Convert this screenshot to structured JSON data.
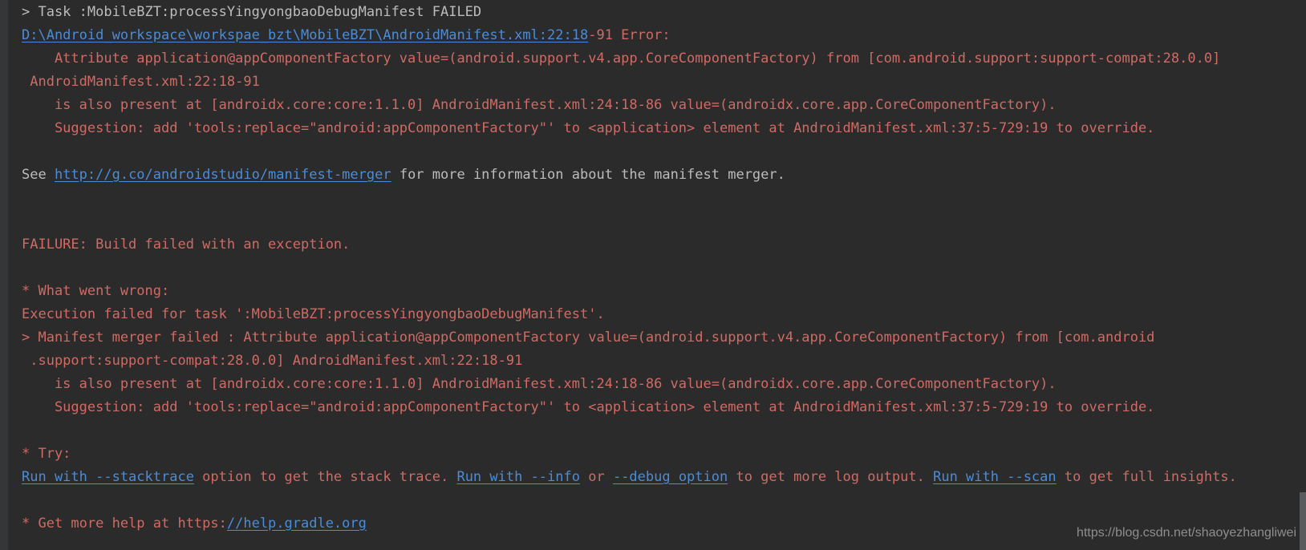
{
  "console": {
    "lines": [
      {
        "segments": [
          {
            "text": "> Task :MobileBZT:processYingyongbaoDebugManifest FAILED",
            "style": "plain"
          }
        ]
      },
      {
        "segments": [
          {
            "text": "D:\\Android_workspace\\workspae_bzt\\MobileBZT\\AndroidManifest.xml:22:18",
            "style": "link",
            "name": "manifest-file-link"
          },
          {
            "text": "-91 Error:",
            "style": "error"
          }
        ]
      },
      {
        "segments": [
          {
            "text": "    Attribute application@appComponentFactory value=(android.support.v4.app.CoreComponentFactory) from [com.android.support:support-compat:28.0.0]",
            "style": "error"
          }
        ]
      },
      {
        "segments": [
          {
            "text": " AndroidManifest.xml:22:18-91",
            "style": "error"
          }
        ]
      },
      {
        "segments": [
          {
            "text": "    is also present at [androidx.core:core:1.1.0] AndroidManifest.xml:24:18-86 value=(androidx.core.app.CoreComponentFactory).",
            "style": "error"
          }
        ]
      },
      {
        "segments": [
          {
            "text": "    Suggestion: add 'tools:replace=\"android:appComponentFactory\"' to <application> element at AndroidManifest.xml:37:5-729:19 to override.",
            "style": "error"
          }
        ]
      },
      {
        "segments": []
      },
      {
        "segments": [
          {
            "text": "See ",
            "style": "plain"
          },
          {
            "text": "http://g.co/androidstudio/manifest-merger",
            "style": "link",
            "name": "manifest-merger-doc-link"
          },
          {
            "text": " for more information about the manifest merger.",
            "style": "plain"
          }
        ]
      },
      {
        "segments": []
      },
      {
        "segments": []
      },
      {
        "segments": [
          {
            "text": "FAILURE: Build failed with an exception.",
            "style": "error"
          }
        ]
      },
      {
        "segments": []
      },
      {
        "segments": [
          {
            "text": "* What went wrong:",
            "style": "error"
          }
        ]
      },
      {
        "segments": [
          {
            "text": "Execution failed for task ':MobileBZT:processYingyongbaoDebugManifest'.",
            "style": "error"
          }
        ]
      },
      {
        "segments": [
          {
            "text": "> Manifest merger failed : Attribute application@appComponentFactory value=(android.support.v4.app.CoreComponentFactory) from [com.android",
            "style": "error"
          }
        ]
      },
      {
        "segments": [
          {
            "text": " .support:support-compat:28.0.0] AndroidManifest.xml:22:18-91",
            "style": "error"
          }
        ]
      },
      {
        "segments": [
          {
            "text": "    is also present at [androidx.core:core:1.1.0] AndroidManifest.xml:24:18-86 value=(androidx.core.app.CoreComponentFactory).",
            "style": "error"
          }
        ]
      },
      {
        "segments": [
          {
            "text": "    Suggestion: add 'tools:replace=\"android:appComponentFactory\"' to <application> element at AndroidManifest.xml:37:5-729:19 to override.",
            "style": "error"
          }
        ]
      },
      {
        "segments": []
      },
      {
        "segments": [
          {
            "text": "* Try:",
            "style": "error"
          }
        ]
      },
      {
        "segments": [
          {
            "text": "Run with --stacktrace",
            "style": "link",
            "name": "run-with-stacktrace-link"
          },
          {
            "text": " option to get the stack trace. ",
            "style": "error"
          },
          {
            "text": "Run with --info",
            "style": "link",
            "name": "run-with-info-link"
          },
          {
            "text": " or ",
            "style": "error"
          },
          {
            "text": "--debug option",
            "style": "link",
            "name": "debug-option-link"
          },
          {
            "text": " to get more log output. ",
            "style": "error"
          },
          {
            "text": "Run with --scan",
            "style": "link",
            "name": "run-with-scan-link"
          },
          {
            "text": " to get full insights.",
            "style": "error"
          }
        ]
      },
      {
        "segments": []
      },
      {
        "segments": [
          {
            "text": "* Get more help at https:",
            "style": "error"
          },
          {
            "text": "//help.gradle.org",
            "style": "link",
            "name": "gradle-help-link"
          }
        ]
      }
    ]
  },
  "watermark": {
    "text": "https://blog.csdn.net/shaoyezhangliwei"
  },
  "colors": {
    "background": "#2b2b2b",
    "error_text": "#d06a64",
    "link_text": "#4a8cd8",
    "plain_text": "#bcbcbc",
    "watermark_text": "#8e8e90"
  }
}
